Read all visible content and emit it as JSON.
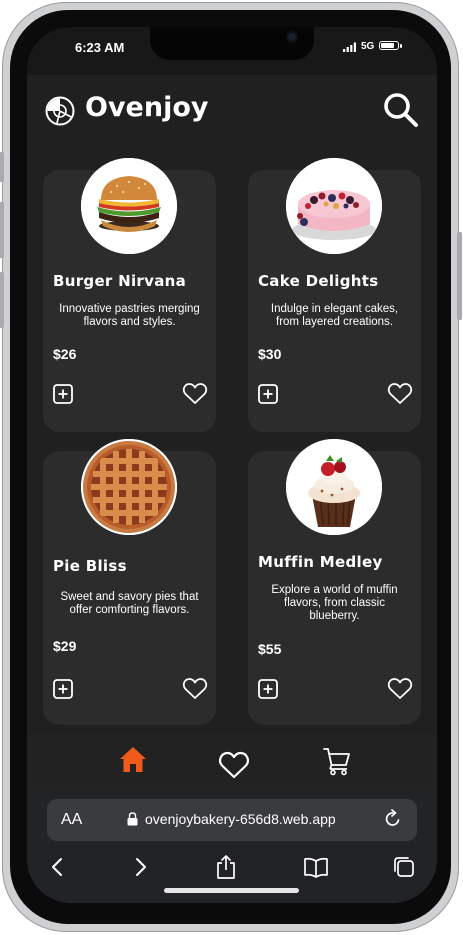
{
  "status": {
    "time": "6:23 AM",
    "network": "5G"
  },
  "app": {
    "brand": "Ovenjoy"
  },
  "products": [
    {
      "title": "Burger Nirvana",
      "desc": "Innovative pastries merging flavors and styles.",
      "price": "$26",
      "image": "burger-image"
    },
    {
      "title": "Cake Delights",
      "desc": "Indulge in elegant cakes, from layered creations.",
      "price": "$30",
      "image": "cake-image"
    },
    {
      "title": "Pie Bliss",
      "desc": "Sweet and savory pies that offer comforting flavors.",
      "price": "$29",
      "image": "pie-image"
    },
    {
      "title": "Muffin Medley",
      "desc": "Explore a world of muffin flavors, from classic blueberry.",
      "price": "$55",
      "image": "muffin-image"
    }
  ],
  "nav": [
    "home-icon",
    "heart-icon",
    "cart-icon"
  ],
  "colors": {
    "accent": "#f05a1a",
    "card": "#2c2c2d",
    "background": "#202020"
  },
  "browser": {
    "text_size": "AA",
    "url": "ovenjoybakery-656d8.web.app"
  }
}
